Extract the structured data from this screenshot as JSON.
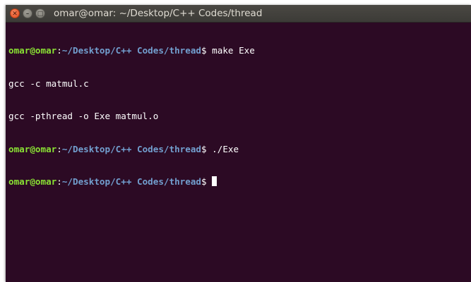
{
  "window": {
    "title": "omar@omar: ~/Desktop/C++ Codes/thread",
    "close_glyph": "✕",
    "minimize_glyph": "–",
    "maximize_glyph": "□"
  },
  "colors": {
    "terminal_bg": "#2c0a24",
    "user_host": "#8ae234",
    "path": "#729fcf",
    "text": "#ffffff"
  },
  "terminal": {
    "lines": [
      {
        "type": "prompt",
        "user": "omar@omar",
        "sep": ":",
        "path": "~/Desktop/C++ Codes/thread",
        "symbol": "$",
        "command": " make Exe"
      },
      {
        "type": "output",
        "text": "gcc -c matmul.c"
      },
      {
        "type": "output",
        "text": "gcc -pthread -o Exe matmul.o"
      },
      {
        "type": "prompt",
        "user": "omar@omar",
        "sep": ":",
        "path": "~/Desktop/C++ Codes/thread",
        "symbol": "$",
        "command": " ./Exe"
      },
      {
        "type": "prompt",
        "user": "omar@omar",
        "sep": ":",
        "path": "~/Desktop/C++ Codes/thread",
        "symbol": "$",
        "command": " "
      }
    ]
  }
}
